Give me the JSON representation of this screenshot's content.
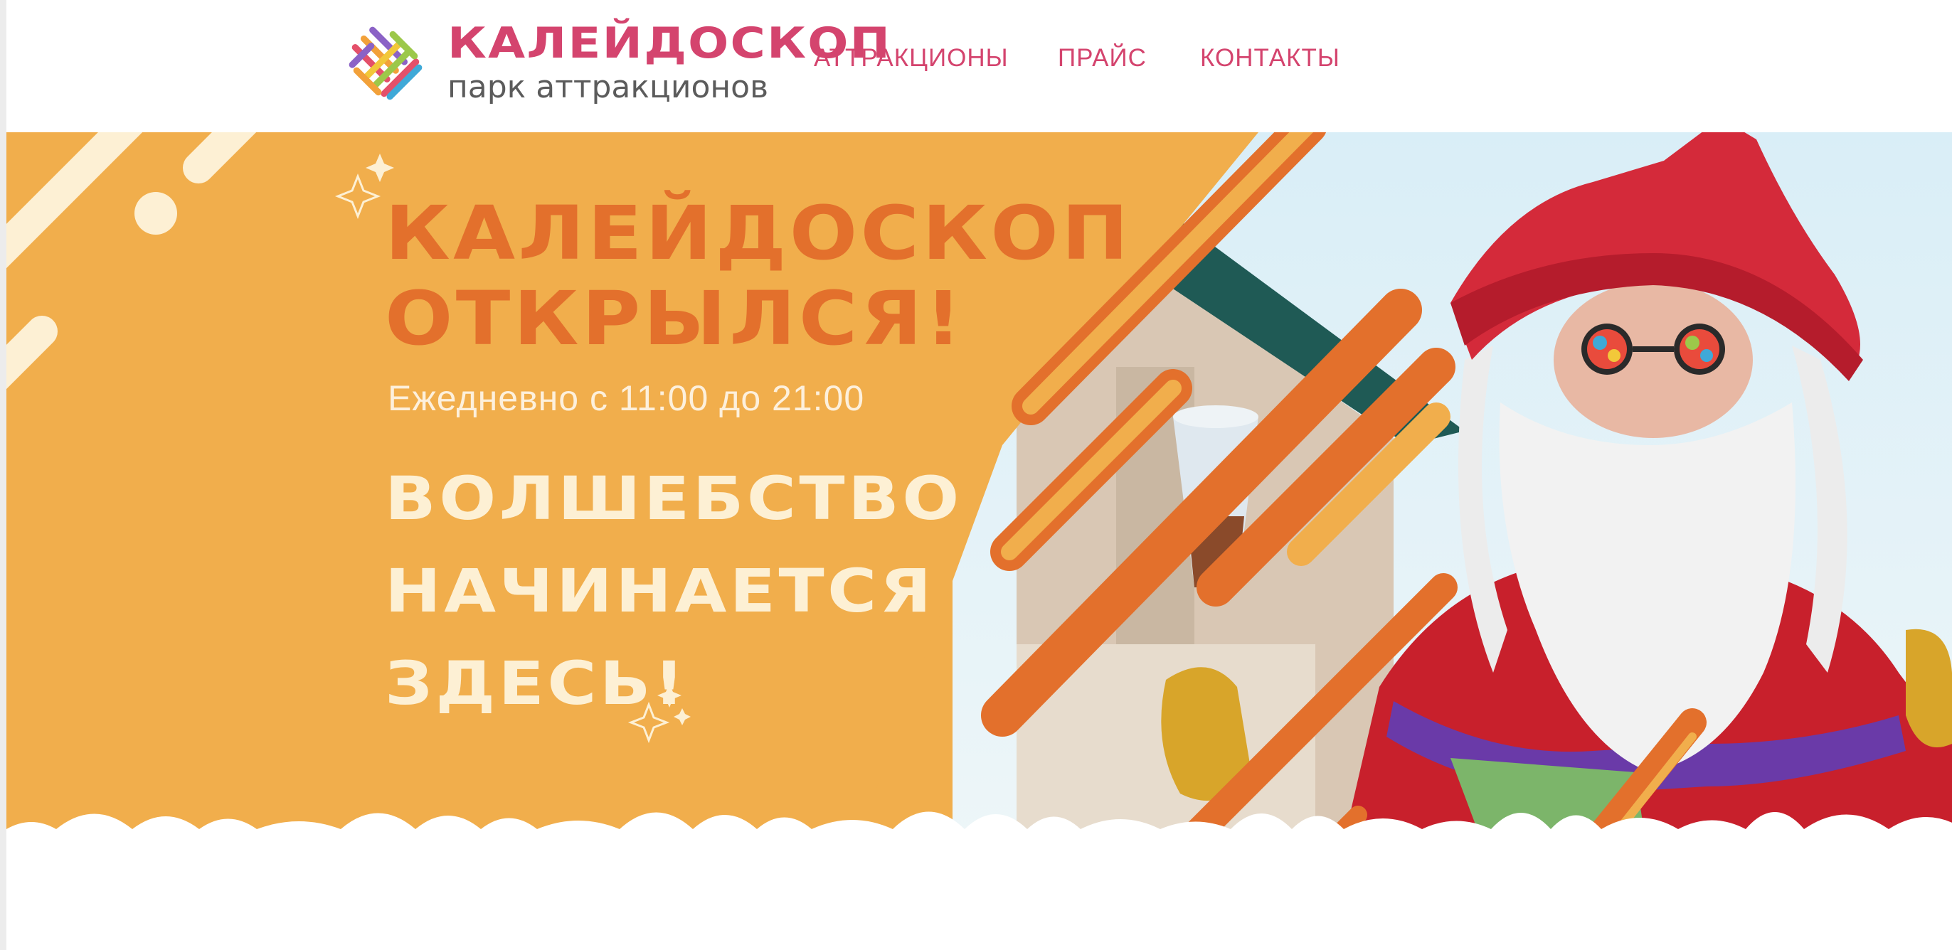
{
  "brand": {
    "title": "КАЛЕЙДОСКОП",
    "subtitle": "парк аттракционов",
    "colors": {
      "pink": "#d4446e",
      "orange": "#f1ae4c",
      "dark_orange": "#e3702c",
      "cream": "#fdf0d4"
    }
  },
  "nav": {
    "items": [
      {
        "label": "АТТРАКЦИОНЫ"
      },
      {
        "label": "ПРАЙС"
      },
      {
        "label": "КОНТАКТЫ"
      }
    ]
  },
  "hero": {
    "title_line1": "КАЛЕЙДОСКОП",
    "title_line2": "ОТКРЫЛСЯ!",
    "hours": "Ежедневно с 11:00 до 21:00",
    "slogan_line1": "ВОЛШЕБСТВО",
    "slogan_line2": "НАЧИНАЕТСЯ",
    "slogan_line3": "ЗДЕСЬ!"
  }
}
